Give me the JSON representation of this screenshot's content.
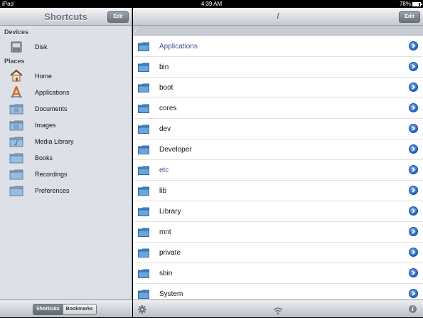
{
  "status": {
    "device": "iPad",
    "time": "4:39 AM",
    "battery": "78%",
    "battery_level": 0.78
  },
  "sidebar": {
    "title": "Shortcuts",
    "edit_label": "Edit",
    "sections": [
      {
        "header": "Devices",
        "items": [
          {
            "label": "Disk",
            "icon": "disk-icon"
          }
        ]
      },
      {
        "header": "Places",
        "items": [
          {
            "label": "Home",
            "icon": "home-icon"
          },
          {
            "label": "Applications",
            "icon": "applications-icon"
          },
          {
            "label": "Documents",
            "icon": "documents-folder-icon"
          },
          {
            "label": "Images",
            "icon": "images-folder-icon"
          },
          {
            "label": "Media Library",
            "icon": "music-folder-icon"
          },
          {
            "label": "Books",
            "icon": "folder-icon"
          },
          {
            "label": "Recordings",
            "icon": "folder-icon"
          },
          {
            "label": "Preferences",
            "icon": "folder-icon"
          }
        ]
      }
    ],
    "tabs": {
      "shortcuts": "Shortcuts",
      "bookmarks": "Bookmarks"
    }
  },
  "main": {
    "title": "/",
    "edit_label": "Edit",
    "path": "/",
    "files": [
      {
        "name": "Applications",
        "special": true
      },
      {
        "name": "bin",
        "special": false
      },
      {
        "name": "boot",
        "special": false
      },
      {
        "name": "cores",
        "special": false
      },
      {
        "name": "dev",
        "special": false
      },
      {
        "name": "Developer",
        "special": false
      },
      {
        "name": "etc",
        "special": true
      },
      {
        "name": "lib",
        "special": false
      },
      {
        "name": "Library",
        "special": false
      },
      {
        "name": "mnt",
        "special": false
      },
      {
        "name": "private",
        "special": false
      },
      {
        "name": "sbin",
        "special": false
      },
      {
        "name": "System",
        "special": false
      }
    ],
    "info_label": "i"
  }
}
